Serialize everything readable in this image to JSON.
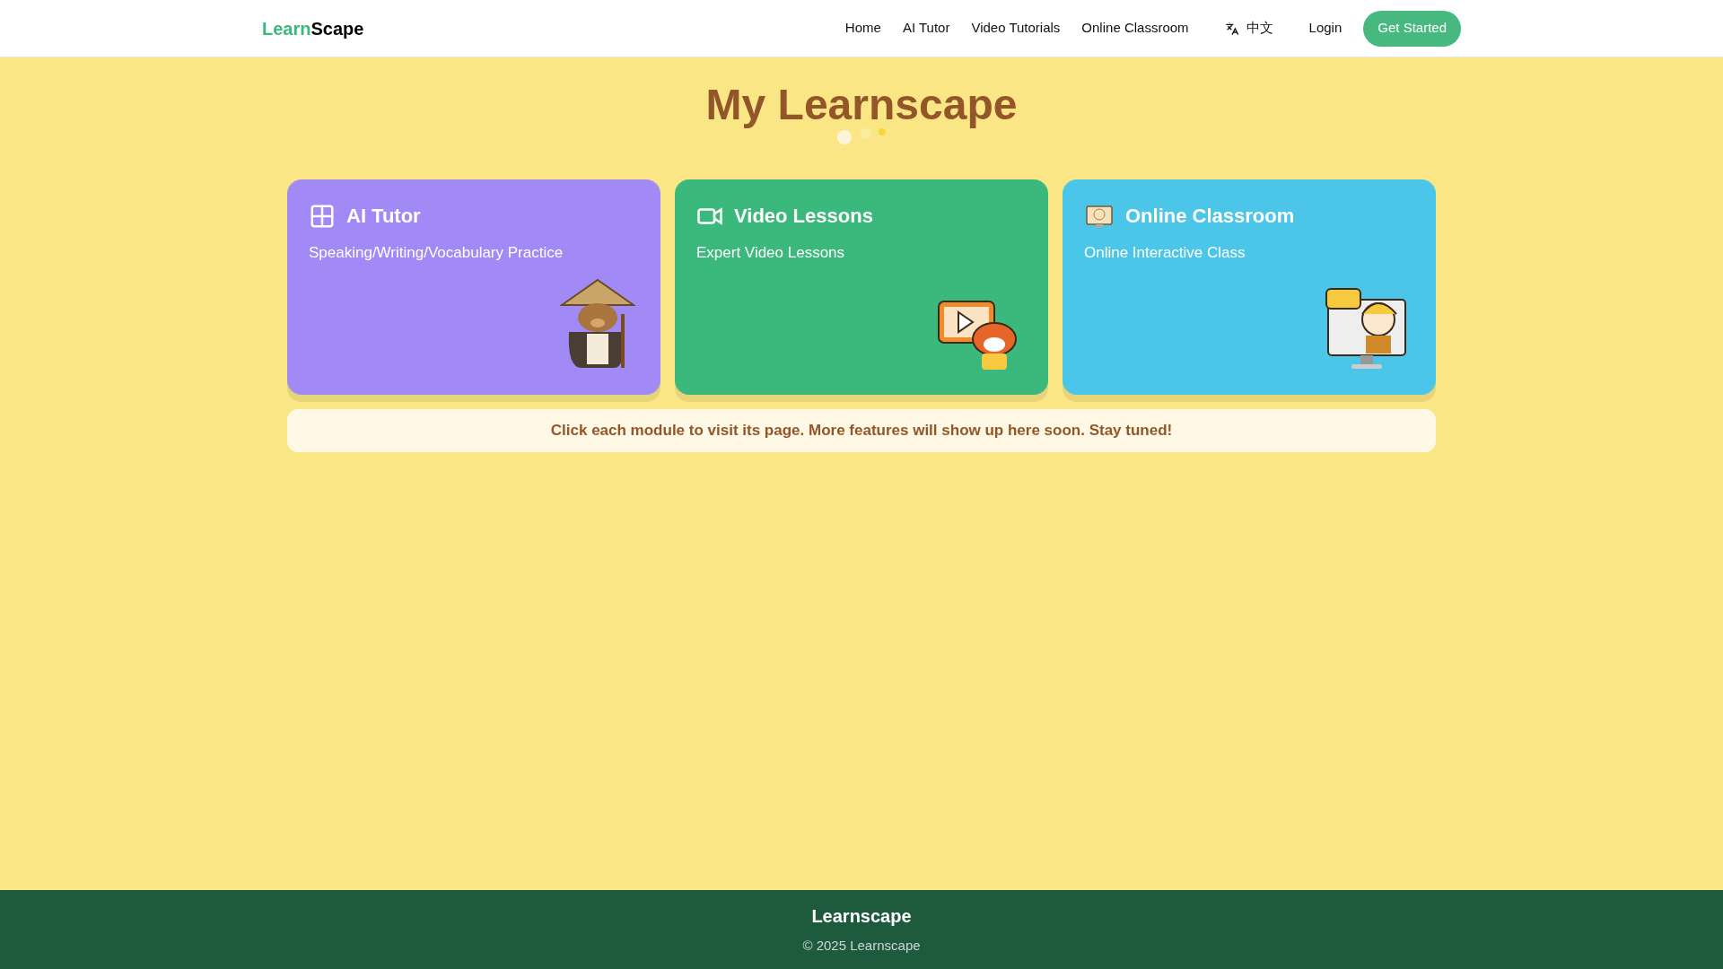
{
  "logo": {
    "first": "Learn",
    "second": "Scape"
  },
  "nav": {
    "links": [
      "Home",
      "AI Tutor",
      "Video Tutorials",
      "Online Classroom"
    ],
    "language": "中文",
    "login": "Login",
    "cta": "Get Started"
  },
  "title": "My Learnscape",
  "cards": [
    {
      "kind": "tutor",
      "color": "#a18af6",
      "title": "AI Tutor",
      "subtitle": "Speaking/Writing/Vocabulary Practice"
    },
    {
      "kind": "video",
      "color": "#3bb87c",
      "title": "Video Lessons",
      "subtitle": "Expert Video Lessons"
    },
    {
      "kind": "classroom",
      "color": "#4cc6e8",
      "title": "Online Classroom",
      "subtitle": "Online Interactive Class"
    }
  ],
  "notice": "Click each module to visit its page. More features will show up here soon. Stay tuned!",
  "footer": {
    "brand": "Learnscape",
    "copyright": "© 2025 Learnscape"
  }
}
